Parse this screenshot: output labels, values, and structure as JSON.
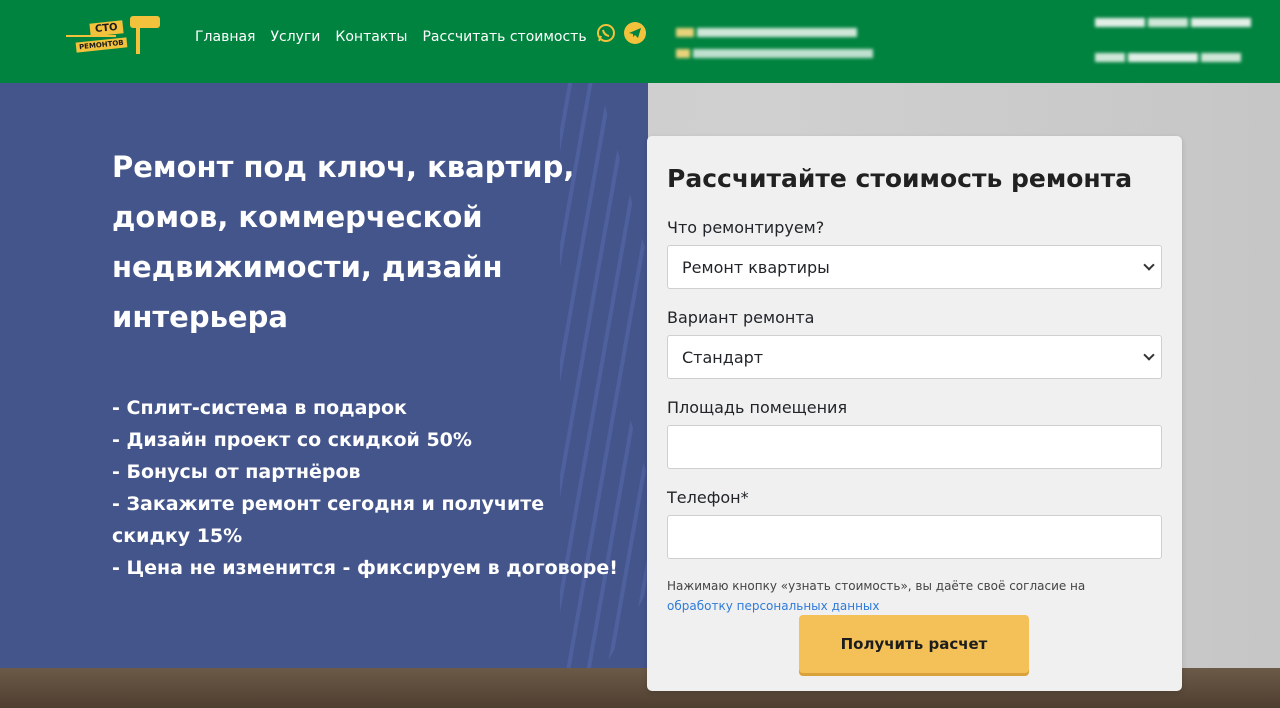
{
  "header": {
    "logo": {
      "top": "СТО",
      "bottom": "РЕМОНТОВ"
    },
    "nav": [
      "Главная",
      "Услуги",
      "Контакты",
      "Рассчитать стоимость"
    ],
    "icons": [
      "whatsapp-icon",
      "telegram-icon"
    ],
    "accent_color": "#00833f",
    "brand_yellow": "#f3c23c"
  },
  "hero": {
    "title": "Ремонт под ключ, квартир, домов, коммерческой недвижимости, дизайн интерьера",
    "benefits": [
      "- Сплит-система в подарок",
      "- Дизайн проект со скидкой 50%",
      "- Бонусы от партнёров",
      "- Закажите ремонт сегодня и получите скидку 15%",
      "- Цена не изменится - фиксируем в договоре!"
    ]
  },
  "form": {
    "title": "Рассчитайте стоимость ремонта",
    "what_label": "Что ремонтируем?",
    "what_value": "Ремонт квартиры",
    "variant_label": "Вариант ремонта",
    "variant_value": "Стандарт",
    "area_label": "Площадь помещения",
    "area_value": "",
    "phone_label": "Телефон*",
    "phone_value": "",
    "consent_text": "Нажимаю кнопку «узнать стоимость», вы даёте своё согласие на ",
    "consent_link": "обработку персональных данных",
    "submit_label": "Получить расчет"
  }
}
